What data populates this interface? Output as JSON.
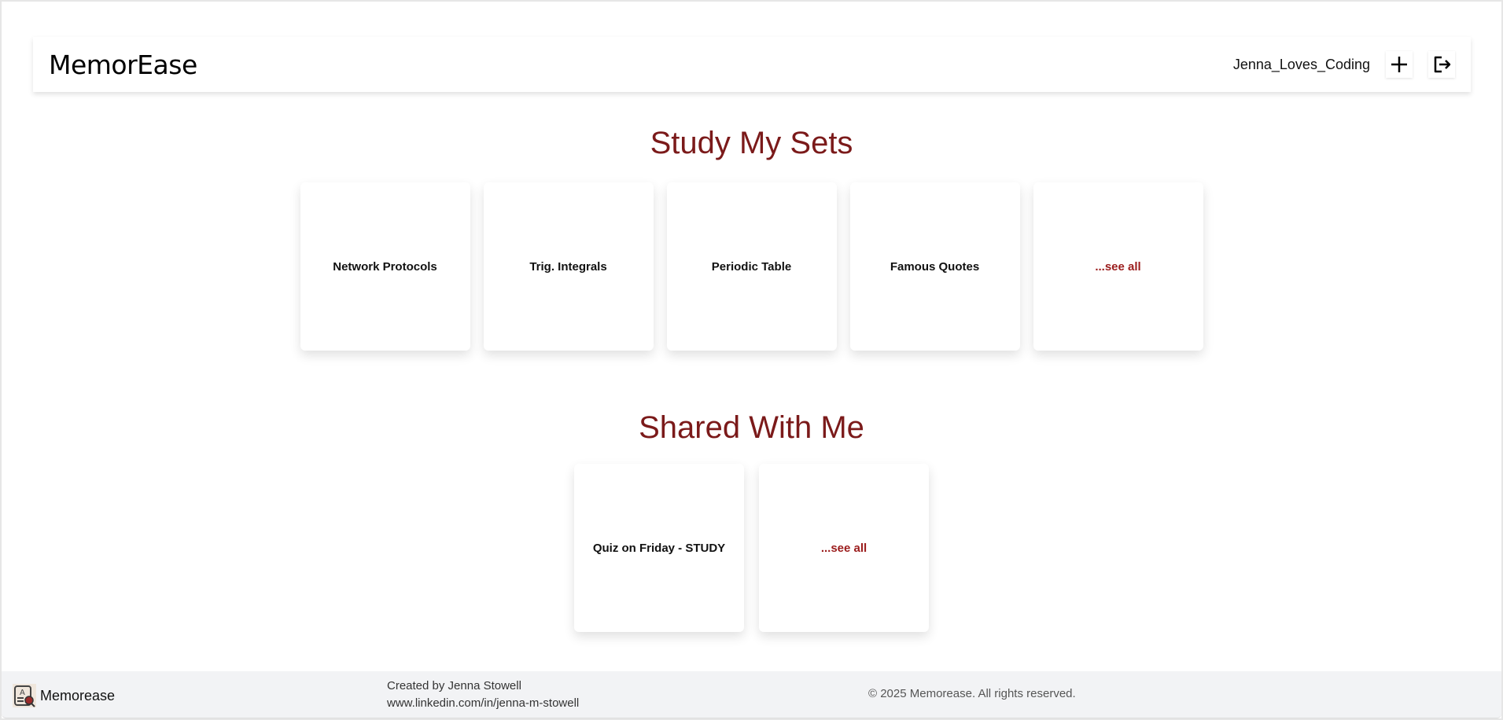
{
  "header": {
    "logo": "MemorEase",
    "username": "Jenna_Loves_Coding",
    "add_icon": "plus-icon",
    "logout_icon": "logout-icon"
  },
  "my_sets": {
    "title": "Study My Sets",
    "items": [
      "Network Protocols",
      "Trig. Integrals",
      "Periodic Table",
      "Famous Quotes"
    ],
    "see_all": "...see all"
  },
  "shared": {
    "title": "Shared With Me",
    "items": [
      "Quiz on Friday - STUDY"
    ],
    "see_all": "...see all"
  },
  "footer": {
    "brand": "Memorease",
    "created_by": "Created by Jenna Stowell",
    "linkedin": "www.linkedin.com/in/jenna-m-stowell",
    "copyright": "© 2025 Memorease. All rights reserved."
  },
  "colors": {
    "accent": "#7b1a1a",
    "see_all": "#9b1c1c",
    "footer_bg": "#f2f3f5"
  }
}
